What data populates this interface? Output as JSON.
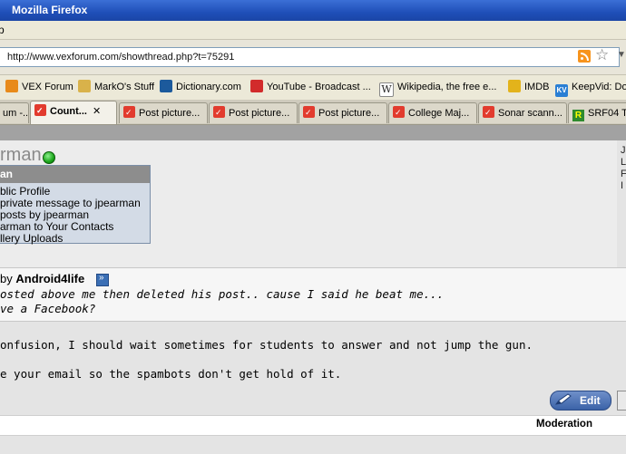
{
  "window": {
    "title": "Mozilla Firefox"
  },
  "menubar": {
    "item": "p"
  },
  "nav": {
    "url": "http://www.vexforum.com/showthread.php?t=75291"
  },
  "bookmarks": [
    {
      "label": "VEX Forum",
      "icon": "vex-icon",
      "color": "#e88a1a"
    },
    {
      "label": "MarkO's Stuff",
      "icon": "folder-icon",
      "color": "#d9b24a"
    },
    {
      "label": "Dictionary.com",
      "icon": "dictionary-icon",
      "color": "#1c5a9c"
    },
    {
      "label": "YouTube - Broadcast ...",
      "icon": "youtube-icon",
      "color": "#d22b2b"
    },
    {
      "label": "Wikipedia, the free e...",
      "icon": "wikipedia-icon",
      "color": "#444444"
    },
    {
      "label": "IMDB",
      "icon": "imdb-icon",
      "color": "#e3b31b"
    },
    {
      "label": "KeepVid: Do",
      "icon": "keepvid-icon",
      "color": "#2a7fd4"
    }
  ],
  "tabs": [
    {
      "label": "um -...",
      "active": false
    },
    {
      "label": "Count...",
      "active": true
    },
    {
      "label": "Post picture...",
      "active": false
    },
    {
      "label": "Post picture...",
      "active": false
    },
    {
      "label": "Post picture...",
      "active": false
    },
    {
      "label": "College Maj...",
      "active": false
    },
    {
      "label": "Sonar scann...",
      "active": false
    },
    {
      "label": "SRF04 T",
      "active": false
    }
  ],
  "profile": {
    "username": "rman",
    "right_info": [
      "J",
      "L",
      "F",
      "I"
    ]
  },
  "popup": {
    "header": "an",
    "items": [
      "blic Profile",
      "private message to jpearman",
      "posts by jpearman",
      "arman to Your Contacts",
      "llery Uploads"
    ]
  },
  "post": {
    "quote_prefix": "by",
    "quote_author": "Android4life",
    "quote_lines": [
      "osted above me then deleted his post.. cause I said he beat me...",
      "ve a Facebook?"
    ],
    "message_lines": [
      "onfusion, I should wait sometimes for students to answer and not jump the gun.",
      "e your email so the spambots don't get hold of it."
    ],
    "edit_label": "Edit",
    "moderation_label": "Moderation"
  }
}
